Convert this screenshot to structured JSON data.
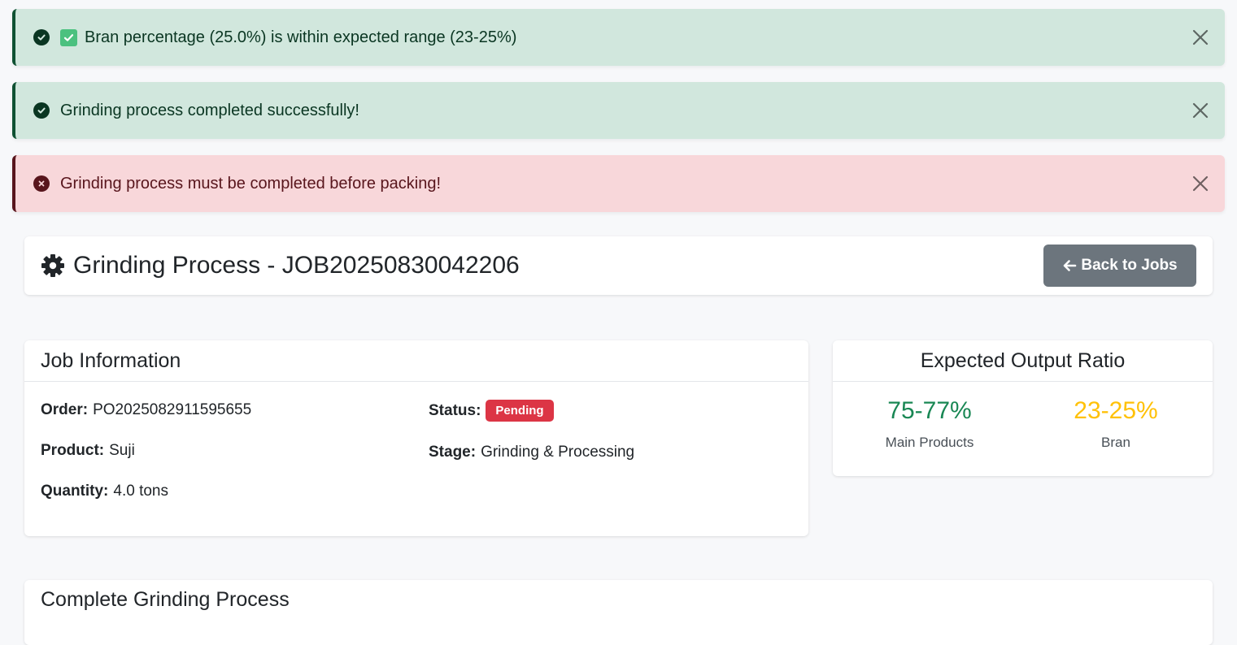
{
  "alerts": [
    {
      "type": "success",
      "icon": "check-circle-icon",
      "emoji": "check-box-icon",
      "text": "Bran percentage (25.0%) is within expected range (23-25%)"
    },
    {
      "type": "success",
      "icon": "check-circle-icon",
      "text": "Grinding process completed successfully!"
    },
    {
      "type": "danger",
      "icon": "x-circle-icon",
      "text": "Grinding process must be completed before packing!"
    }
  ],
  "header": {
    "title": "Grinding Process - JOB20250830042206",
    "back_label": "Back to Jobs"
  },
  "job_info": {
    "title": "Job Information",
    "order_label": "Order:",
    "order_value": "PO2025082911595655",
    "product_label": "Product:",
    "product_value": "Suji",
    "quantity_label": "Quantity:",
    "quantity_value": "4.0 tons",
    "status_label": "Status:",
    "status_value": "Pending",
    "stage_label": "Stage:",
    "stage_value": "Grinding & Processing"
  },
  "output_ratio": {
    "title": "Expected Output Ratio",
    "main_value": "75-77%",
    "main_label": "Main Products",
    "bran_value": "23-25%",
    "bran_label": "Bran"
  },
  "complete": {
    "title": "Complete Grinding Process"
  },
  "colors": {
    "success_bg": "#d1e7dd",
    "danger_bg": "#f8d7da",
    "badge_danger": "#dc3545",
    "main_green": "#198754",
    "bran_yellow": "#ffc107",
    "secondary_btn": "#6c757d"
  }
}
